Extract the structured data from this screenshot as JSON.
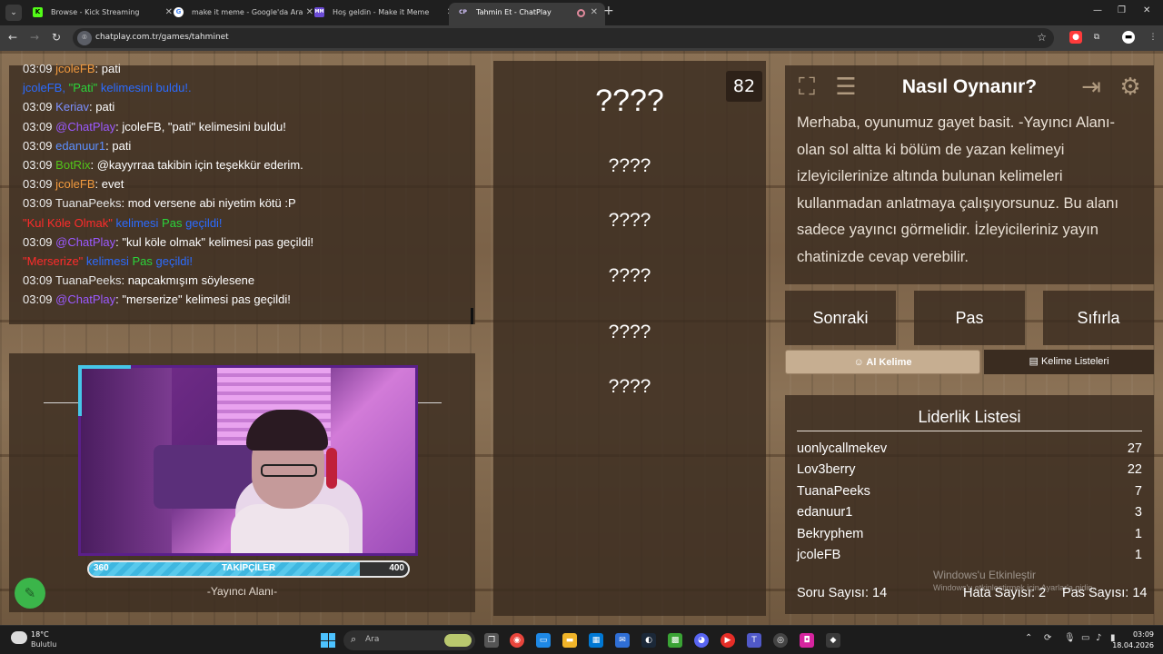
{
  "browser": {
    "tabs": [
      {
        "title": "Browse - Kick Streaming",
        "favicon": "K"
      },
      {
        "title": "make it meme - Google'da Ara",
        "favicon": "G"
      },
      {
        "title": "Hoş geldin - Make it Meme",
        "favicon": "MM"
      },
      {
        "title": "Tahmin Et - ChatPlay",
        "favicon": "CP"
      }
    ],
    "url": "chatplay.com.tr/games/tahminet"
  },
  "chat": {
    "lines": [
      {
        "time": "03:09",
        "user": "jcoleFB",
        "msg": "pati"
      },
      {
        "sys_user": "jcoleFB,",
        "sys_word": "\"Pati\"",
        "sys_text": "kelimesini buldu!."
      },
      {
        "time": "03:09",
        "user": "Keriav",
        "msg": "pati"
      },
      {
        "time": "03:09",
        "user": "@ChatPlay",
        "msg": "jcoleFB, \"pati\" kelimesini buldu!"
      },
      {
        "time": "03:09",
        "user": "edanuur1",
        "msg": "pati"
      },
      {
        "time": "03:09",
        "user": "BotRix",
        "msg": "@kayyrraa takibin için teşekkür ederim."
      },
      {
        "time": "03:09",
        "user": "jcoleFB",
        "msg": "evet"
      },
      {
        "time": "03:09",
        "user": "TuanaPeeks",
        "msg": "mod versene abi niyetim kötü :P"
      },
      {
        "sys_word": "\"Kul Köle Olmak\"",
        "sys_text": "kelimesi",
        "sys_pas": "Pas",
        "sys_end": "geçildi!"
      },
      {
        "time": "03:09",
        "user": "@ChatPlay",
        "msg": "\"kul köle olmak\" kelimesi pas geçildi!"
      },
      {
        "sys_word": "\"Merserize\"",
        "sys_text": "kelimesi",
        "sys_pas": "Pas",
        "sys_end": "geçildi!"
      },
      {
        "time": "03:09",
        "user": "TuanaPeeks",
        "msg": "napcakmışım söylesene"
      },
      {
        "time": "03:09",
        "user": "@ChatPlay",
        "msg": "\"merserize\" kelimesi pas geçildi!"
      }
    ]
  },
  "followers": {
    "min": "360",
    "max": "400",
    "label": "TAKİPÇİLER",
    "progress": 0.85
  },
  "streamer_area": "-Yayıncı Alanı-",
  "words": {
    "counter": "82",
    "items": [
      "????",
      "????",
      "????",
      "????",
      "????",
      "????"
    ]
  },
  "help": {
    "title": "Nasıl Oynanır?",
    "text": "Merhaba, oyunumuz gayet basit. -Yayıncı Alanı- olan sol altta ki bölüm de yazan kelimeyi izleyicilerinize altında bulunan kelimeleri kullanmadan anlatmaya çalışıyorsunuz. Bu alanı sadece yayıncı görmelidir. İzleyicileriniz yayın chatinizde cevap verebilir."
  },
  "actions": {
    "next": "Sonraki",
    "pass": "Pas",
    "reset": "Sıfırla"
  },
  "word_tabs": {
    "ai_word": "Al Kelime",
    "word_lists": "Kelime Listeleri"
  },
  "leaderboard": {
    "title": "Liderlik Listesi",
    "rows": [
      {
        "name": "uonlycallmekev",
        "score": "27"
      },
      {
        "name": "Lov3berry",
        "score": "22"
      },
      {
        "name": "TuanaPeeks",
        "score": "7"
      },
      {
        "name": "edanuur1",
        "score": "3"
      },
      {
        "name": "Bekryphem",
        "score": "1"
      },
      {
        "name": "jcoleFB",
        "score": "1"
      }
    ],
    "question_count": "Soru Sayısı: 14",
    "error_count": "Hata Sayısı: 2",
    "pass_count": "Pas Sayısı: 14"
  },
  "watermark": {
    "title": "Windows'u Etkinleştir",
    "sub": "Windows'u etkinleştirmek için Ayarlar'a gidin."
  },
  "taskbar": {
    "weather_temp": "18°C",
    "weather_desc": "Bulutlu",
    "search_placeholder": "Ara",
    "time": "03:09",
    "date": "18.04.2026"
  }
}
